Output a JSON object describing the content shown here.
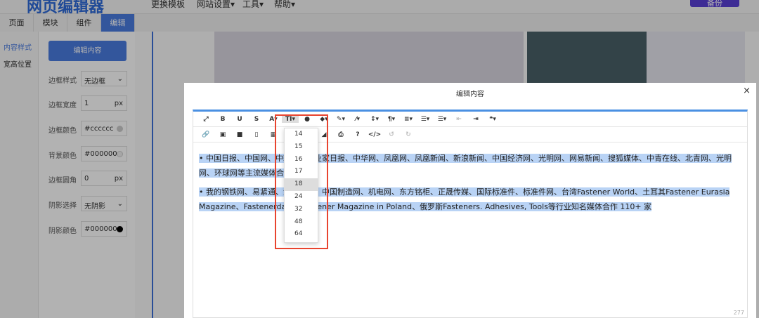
{
  "header": {
    "logo": "网页编辑器",
    "menus": [
      "更换模板",
      "网站设置▾",
      "工具▾",
      "帮助▾"
    ],
    "backup": "备份"
  },
  "tabs": [
    "页面",
    "模块",
    "组件",
    "编辑"
  ],
  "side_nav": [
    "内容样式",
    "宽高位置"
  ],
  "panel": {
    "edit_button": "编辑内容",
    "rows": [
      {
        "label": "边框样式",
        "value": "无边框",
        "suffix": "⌄"
      },
      {
        "label": "边框宽度",
        "value": "1",
        "suffix": "px"
      },
      {
        "label": "边框颜色",
        "value": "#cccccc",
        "suffix": ""
      },
      {
        "label": "背景颜色",
        "value": "#000000",
        "suffix": ""
      },
      {
        "label": "边框圆角",
        "value": "0",
        "suffix": "px"
      },
      {
        "label": "阴影选择",
        "value": "无阴影",
        "suffix": "⌄"
      },
      {
        "label": "阴影颜色",
        "value": "#000000",
        "suffix": ""
      }
    ]
  },
  "colors": {
    "accent": "#4a7be0",
    "border_dot": "#cccccc",
    "shadow_dot": "#000000",
    "highlight": "#e8442f"
  },
  "modal": {
    "title": "编辑内容",
    "close": "×",
    "toolbar_row1": [
      "⤢",
      "B",
      "U",
      "S",
      "A▾",
      "TI▾",
      "●",
      "◆▾",
      "✎▾",
      "⁄▾",
      "↕▾",
      "¶▾",
      "≡▾",
      "☰▾",
      "☰▾",
      "⇤",
      "⇥",
      "❝▾"
    ],
    "toolbar_row2": [
      "🔗",
      "▣",
      "■",
      "▯",
      "▦",
      "—",
      "↖",
      "◢",
      "⎙",
      "?",
      "</>",
      "↺",
      "↻"
    ],
    "paragraphs": [
      "• 中国日报、中国网、中新网、企业家日报、中华网、凤凰网、凤凰新闻、新浪新闻、中国经济网、光明网、网易新闻、搜狐媒体、中青在线、北青网、光明网、环球网等主流媒体合作 ...",
      "• 我的钢铁网、易紧通、金属件网、中国制造网、机电网、东方铭柜、正晟传媒、国际标准件、标准件网、台湾Fastener World、土耳其Fastener Eurasia Magazine、Fastenerdata、Fastener Magazine in Poland、俄罗斯Fasteners. Adhesives, Tools等行业知名媒体合作 110+ 家"
    ],
    "word_count": "277",
    "font_sizes": [
      "14",
      "15",
      "16",
      "17",
      "18",
      "24",
      "32",
      "48",
      "64"
    ],
    "selected_size": "18"
  }
}
